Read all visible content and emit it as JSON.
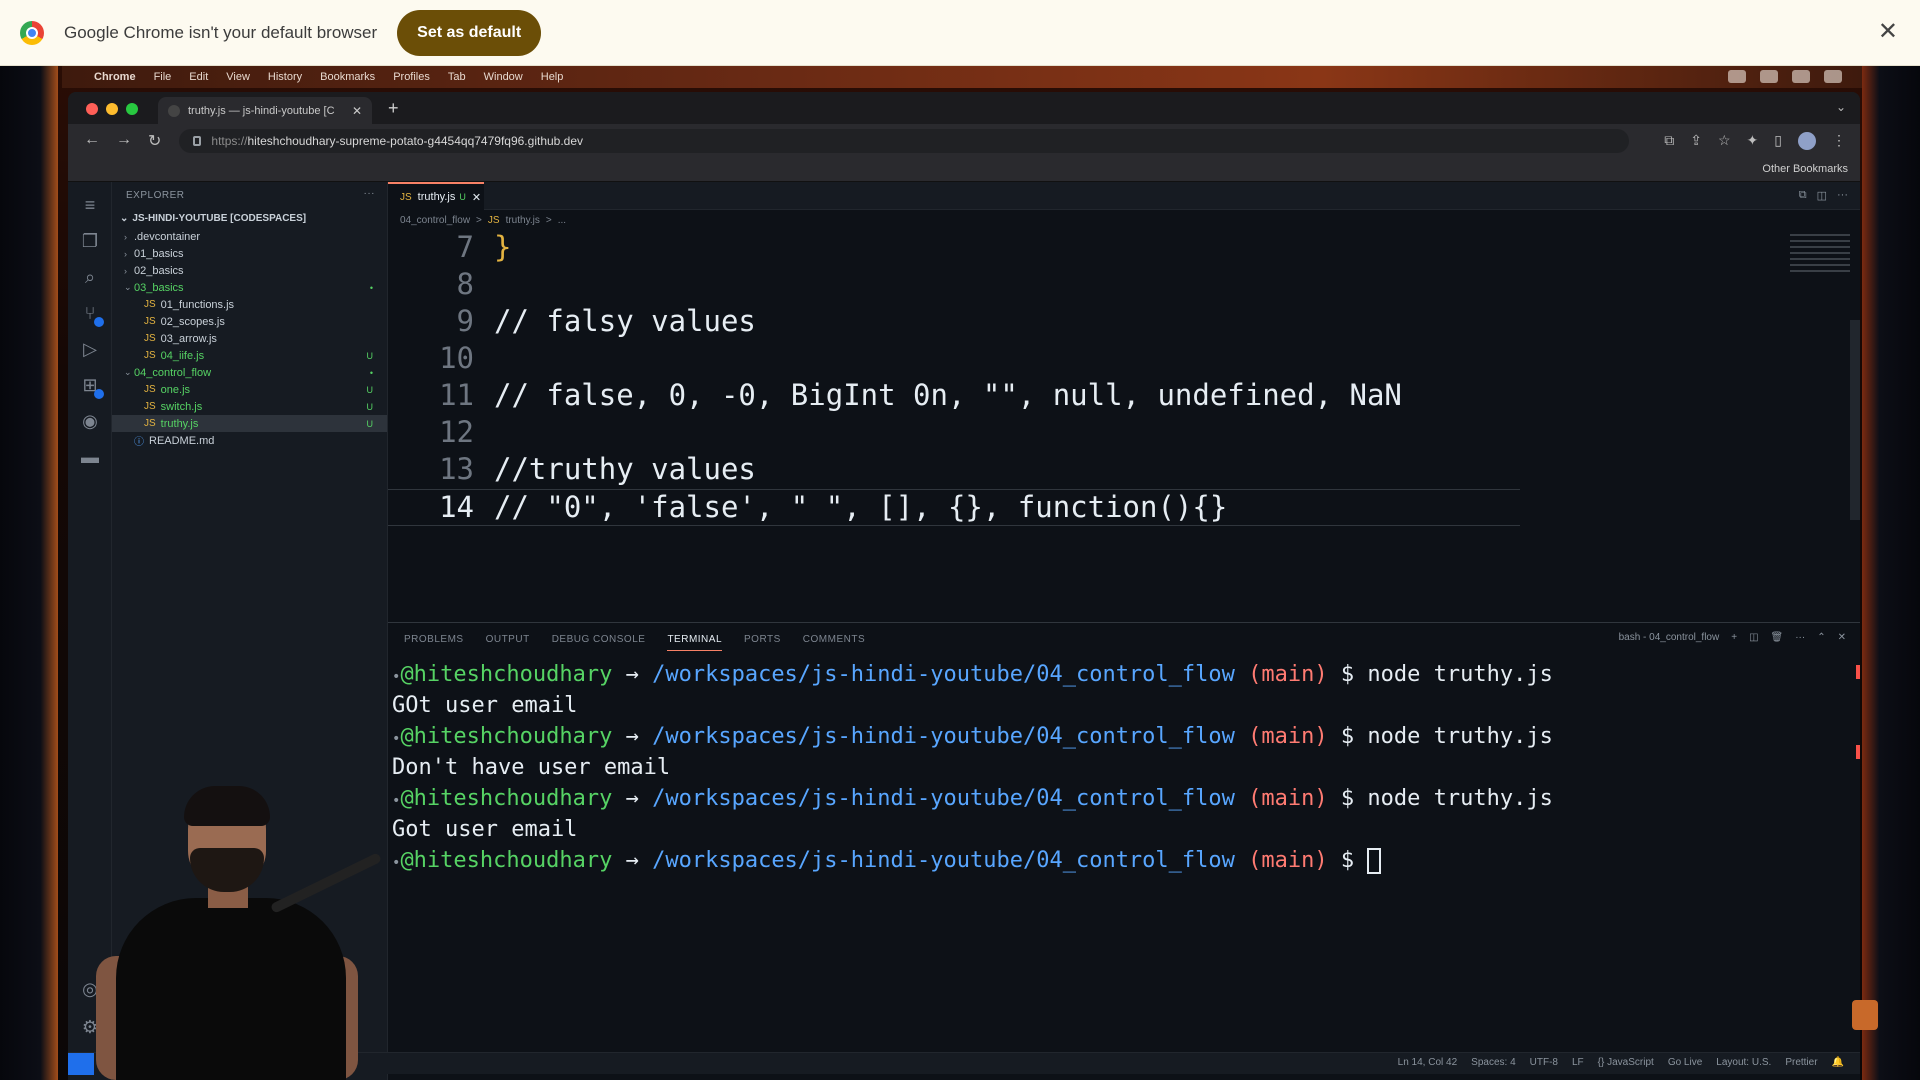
{
  "infobar": {
    "message": "Google Chrome isn't your default browser",
    "set_default": "Set as default",
    "close_glyph": "✕"
  },
  "menubar": {
    "apple": "",
    "items": [
      "Chrome",
      "File",
      "Edit",
      "View",
      "History",
      "Bookmarks",
      "Profiles",
      "Tab",
      "Window",
      "Help"
    ]
  },
  "browser": {
    "tab_title": "truthy.js — js-hindi-youtube [C",
    "tab_close": "✕",
    "new_tab": "+",
    "tab_menu": "⌄",
    "url_scheme": "https://",
    "url_host": "hiteshchoudhary-supreme-potato-g4454qq7479fq96.github.dev",
    "other_bookmarks": "Other Bookmarks"
  },
  "vscode": {
    "explorer_title": "EXPLORER",
    "explorer_more": "···",
    "root_folder": "JS-HINDI-YOUTUBE [CODESPACES]",
    "tree": [
      {
        "label": ".devcontainer",
        "type": "folder",
        "indent": 1,
        "open": false
      },
      {
        "label": "01_basics",
        "type": "folder",
        "indent": 1,
        "open": false
      },
      {
        "label": "02_basics",
        "type": "folder",
        "indent": 1,
        "open": false
      },
      {
        "label": "03_basics",
        "type": "folder",
        "indent": 1,
        "open": true,
        "green": true,
        "mark": "•"
      },
      {
        "label": "01_functions.js",
        "type": "js",
        "indent": 2
      },
      {
        "label": "02_scopes.js",
        "type": "js",
        "indent": 2
      },
      {
        "label": "03_arrow.js",
        "type": "js",
        "indent": 2
      },
      {
        "label": "04_iife.js",
        "type": "js",
        "indent": 2,
        "green": true,
        "mark": "U"
      },
      {
        "label": "04_control_flow",
        "type": "folder",
        "indent": 1,
        "open": true,
        "green": true,
        "mark": "•"
      },
      {
        "label": "one.js",
        "type": "js",
        "indent": 2,
        "green": true,
        "mark": "U"
      },
      {
        "label": "switch.js",
        "type": "js",
        "indent": 2,
        "green": true,
        "mark": "U"
      },
      {
        "label": "truthy.js",
        "type": "js",
        "indent": 2,
        "green": true,
        "mark": "U",
        "selected": true
      },
      {
        "label": "README.md",
        "type": "md",
        "indent": 1
      }
    ],
    "editor_tab": "truthy.js",
    "editor_tab_status": "U",
    "breadcrumb": [
      "04_control_flow",
      ">",
      "truthy.js",
      ">",
      "..."
    ],
    "code_lines": [
      {
        "n": "7",
        "text": "}"
      },
      {
        "n": "8",
        "text": ""
      },
      {
        "n": "9",
        "text": "// falsy values"
      },
      {
        "n": "10",
        "text": ""
      },
      {
        "n": "11",
        "text": "// false, 0, -0, BigInt 0n, \"\", null, undefined, NaN"
      },
      {
        "n": "12",
        "text": ""
      },
      {
        "n": "13",
        "text": "//truthy values"
      },
      {
        "n": "14",
        "text": "// \"0\", 'false', \" \", [], {}, function(){}"
      }
    ],
    "panel_tabs": [
      "PROBLEMS",
      "OUTPUT",
      "DEBUG CONSOLE",
      "TERMINAL",
      "PORTS",
      "COMMENTS"
    ],
    "active_panel_tab": "TERMINAL",
    "terminal_shell": "bash - 04_control_flow",
    "terminal": {
      "user": "@hiteshchoudhary",
      "arrow": "→",
      "path": "/workspaces/js-hindi-youtube/04_control_flow",
      "branch": "main",
      "prompt": "$",
      "command": "node truthy.js",
      "outputs": [
        "GOt user email",
        "Don't have user email",
        "Got user email"
      ]
    },
    "status": [
      "Ln 14, Col 42",
      "Spaces: 4",
      "UTF-8",
      "LF",
      "{} JavaScript",
      "Go Live",
      "Layout: U.S.",
      "Prettier"
    ]
  },
  "colors": {
    "infobar_bg": "#fdfaf0",
    "set_default_bg": "#6b4e07",
    "editor_bg": "#0d1117",
    "terminal_user": "#56d364",
    "terminal_path": "#58a6ff",
    "terminal_branch": "#ff7b72",
    "brace": "#e3b341"
  }
}
